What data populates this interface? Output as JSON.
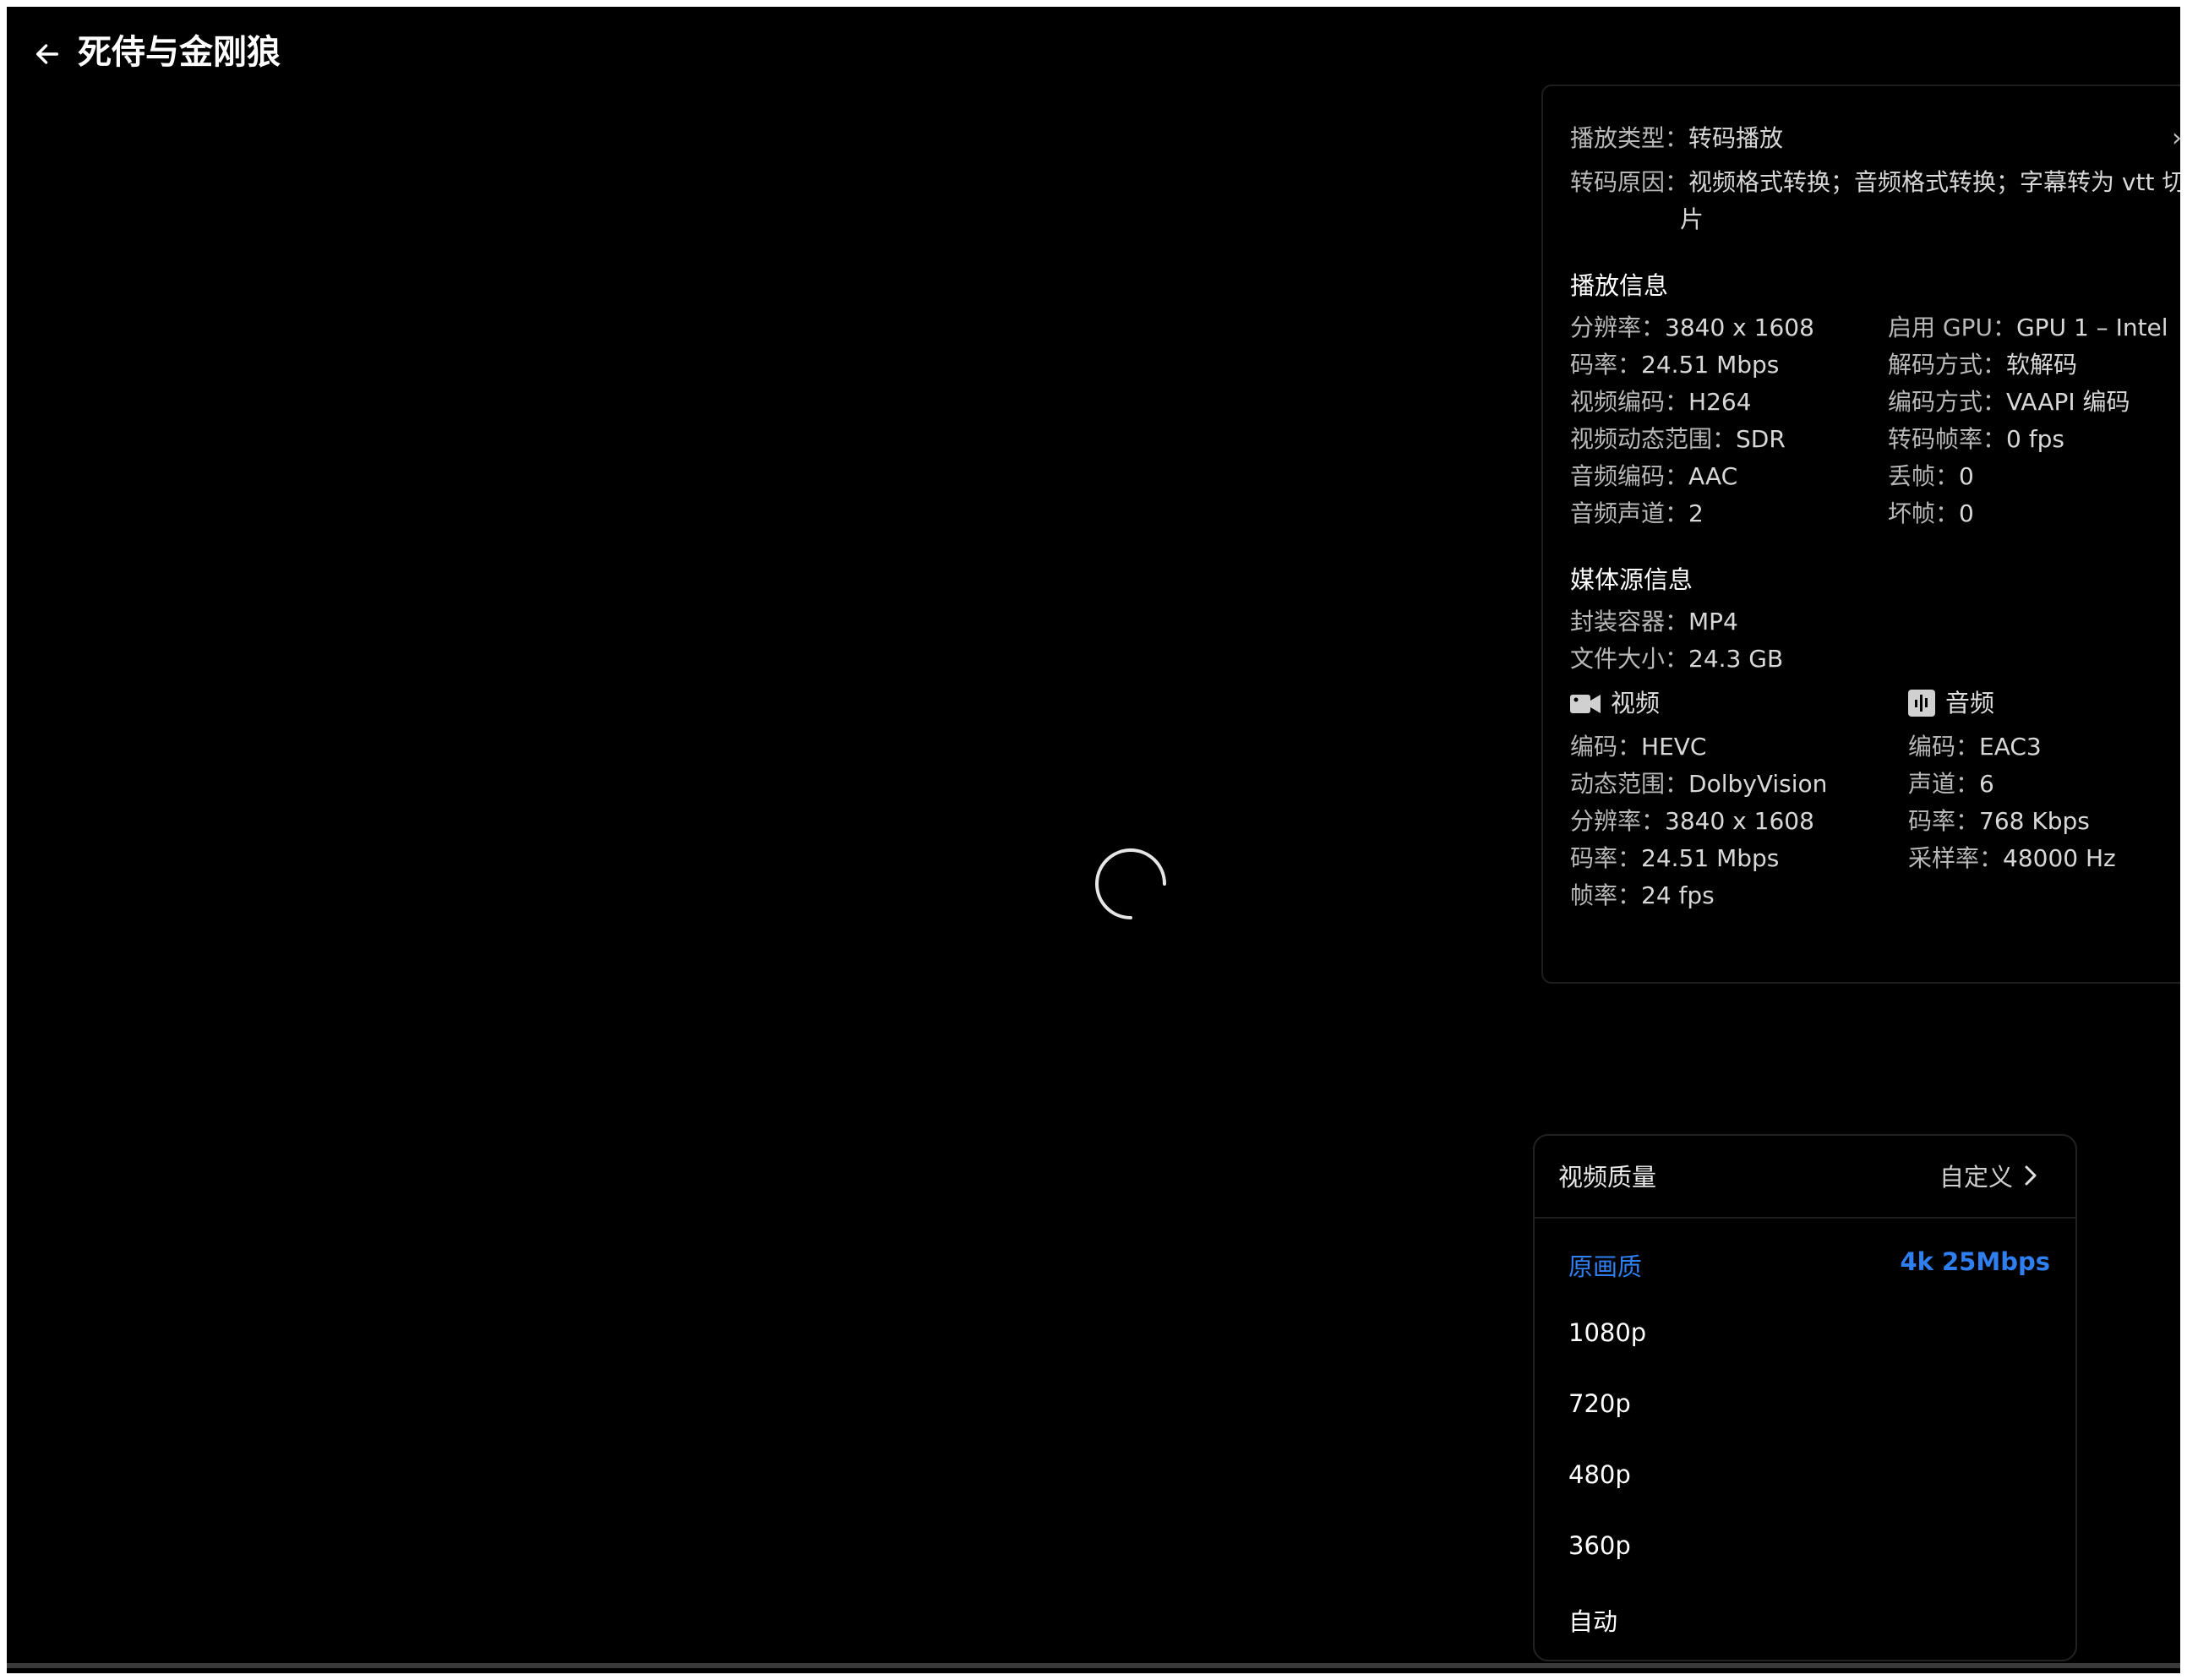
{
  "header": {
    "title": "死侍与金刚狼"
  },
  "info": {
    "play_type": {
      "label": "播放类型：",
      "value": "转码播放"
    },
    "reason": {
      "label": "转码原因：",
      "value_line1": "视频格式转换；音频格式转换；字幕转为 vtt 切",
      "value_line2": "片"
    },
    "playback_title": "播放信息",
    "playback_left": [
      {
        "label": "分辨率：",
        "value": "3840 x 1608"
      },
      {
        "label": "码率：",
        "value": "24.51 Mbps"
      },
      {
        "label": "视频编码：",
        "value": "H264"
      },
      {
        "label": "视频动态范围：",
        "value": "SDR"
      },
      {
        "label": "音频编码：",
        "value": "AAC"
      },
      {
        "label": "音频声道：",
        "value": "2"
      }
    ],
    "playback_right": [
      {
        "label": "启用 GPU：",
        "value": "GPU 1 – Intel"
      },
      {
        "label": "解码方式：",
        "value": "软解码"
      },
      {
        "label": "编码方式：",
        "value": "VAAPI 编码"
      },
      {
        "label": "转码帧率：",
        "value": "0 fps"
      },
      {
        "label": "丢帧：",
        "value": "0"
      },
      {
        "label": "坏帧：",
        "value": "0"
      }
    ],
    "source_title": "媒体源信息",
    "source_rows": [
      {
        "label": "封装容器：",
        "value": "MP4"
      },
      {
        "label": "文件大小：",
        "value": "24.3 GB"
      }
    ],
    "video_head": "视频",
    "video_rows": [
      {
        "label": "编码：",
        "value": "HEVC"
      },
      {
        "label": "动态范围：",
        "value": "DolbyVision"
      },
      {
        "label": "分辨率：",
        "value": "3840 x 1608"
      },
      {
        "label": "码率：",
        "value": "24.51 Mbps"
      },
      {
        "label": "帧率：",
        "value": "24 fps"
      }
    ],
    "audio_head": "音频",
    "audio_rows": [
      {
        "label": "编码：",
        "value": "EAC3"
      },
      {
        "label": "声道：",
        "value": "6"
      },
      {
        "label": "码率：",
        "value": "768 Kbps"
      },
      {
        "label": "采样率：",
        "value": "48000 Hz"
      }
    ],
    "close_glyph": "›"
  },
  "quality": {
    "title": "视频质量",
    "custom_label": "自定义",
    "items": [
      {
        "name": "原画质",
        "detail": "4k 25Mbps",
        "active": true
      },
      {
        "name": "1080p"
      },
      {
        "name": "720p"
      },
      {
        "name": "480p"
      },
      {
        "name": "360p"
      },
      {
        "name": "自动"
      }
    ]
  },
  "colors": {
    "accent": "#2f7ff0",
    "background": "#000000"
  }
}
